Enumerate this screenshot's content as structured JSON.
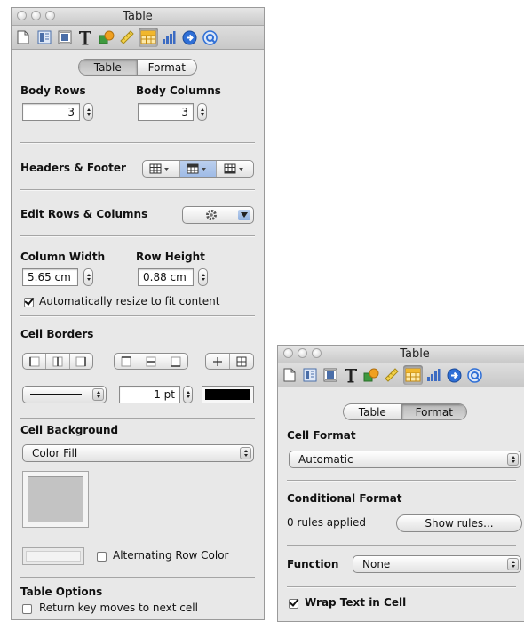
{
  "window1": {
    "title": "Table",
    "tabs": [
      "Table",
      "Format"
    ],
    "active_tab": "Table",
    "toolbar_icons": [
      "document-icon",
      "layout-icon",
      "wrap-icon",
      "text-icon",
      "graphic-icon",
      "ruler-icon",
      "table-icon",
      "chart-icon",
      "link-icon",
      "info-icon"
    ],
    "body_rows_label": "Body Rows",
    "body_rows_value": "3",
    "body_columns_label": "Body Columns",
    "body_columns_value": "3",
    "headers_footer_label": "Headers & Footer",
    "edit_rows_label": "Edit Rows & Columns",
    "column_width_label": "Column Width",
    "column_width_value": "5.65 cm",
    "row_height_label": "Row Height",
    "row_height_value": "0.88 cm",
    "auto_resize_label": "Automatically resize to fit content",
    "auto_resize_checked": true,
    "cell_borders_label": "Cell Borders",
    "border_width_value": "1 pt",
    "border_color": "#000000",
    "cell_background_label": "Cell Background",
    "fill_value": "Color Fill",
    "fill_color": "#c3c3c3",
    "alternating_label": "Alternating Row Color",
    "alternating_checked": false,
    "table_options_label": "Table Options",
    "return_key_label": "Return key moves to next cell",
    "return_key_checked": false
  },
  "window2": {
    "title": "Table",
    "tabs": [
      "Table",
      "Format"
    ],
    "active_tab": "Format",
    "cell_format_label": "Cell Format",
    "cell_format_value": "Automatic",
    "conditional_format_label": "Conditional Format",
    "rules_applied_text": "0 rules applied",
    "show_rules_label": "Show rules...",
    "function_label": "Function",
    "function_value": "None",
    "wrap_text_label": "Wrap Text in Cell",
    "wrap_text_checked": true
  },
  "colors": {
    "panel_bg": "#e8e8e8",
    "active_segment": "#c4c4c4",
    "highlight_blue": "#a9c3ea"
  }
}
